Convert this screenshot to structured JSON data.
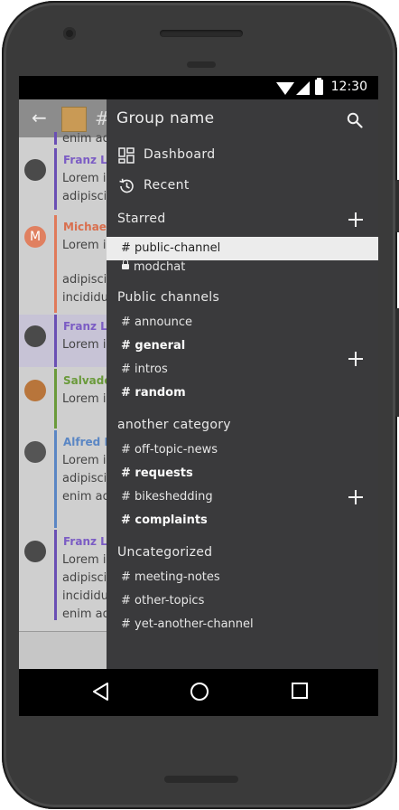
{
  "status_bar": {
    "time": "12:30"
  },
  "app_behind": {
    "header_hash": "#",
    "messages": [
      {
        "name": "Franz Lis",
        "name_color": "#7b5cc4",
        "bar_color": "#6a4fb4",
        "avatar_color": "#4a4a4a",
        "lines": [
          "Lorem ip",
          "adipisci"
        ],
        "highlight": false
      },
      {
        "name": "Michaeh",
        "name_color": "#d96f4e",
        "bar_color": "#e07a5a",
        "avatar_color": "#e08060",
        "avatar_letter": "M",
        "lines": [
          "Lorem ip",
          "adipisci",
          "incididu"
        ],
        "highlight": false
      },
      {
        "name": "Franz Lis",
        "name_color": "#7b5cc4",
        "bar_color": "#6a4fb4",
        "avatar_color": "#4a4a4a",
        "lines": [
          "Lorem ip"
        ],
        "highlight": true
      },
      {
        "name": "Salvador",
        "name_color": "#6a9a3a",
        "bar_color": "#6a9a3a",
        "avatar_color": "#b8753b",
        "lines": [
          "Lorem ip"
        ],
        "highlight": false
      },
      {
        "name": "Alfred H",
        "name_color": "#5a86c4",
        "bar_color": "#5a86c4",
        "avatar_color": "#555555",
        "lines": [
          "Lorem ip",
          "adipisci",
          "enim ad"
        ],
        "highlight": false
      },
      {
        "name": "Franz Lis",
        "name_color": "#7b5cc4",
        "bar_color": "#6a4fb4",
        "avatar_color": "#4a4a4a",
        "lines": [
          "Lorem ip",
          "adipisci",
          "incididu",
          "enim ad"
        ],
        "highlight": false
      }
    ],
    "top_partial_line": "enim ad"
  },
  "drawer": {
    "group_name": "Group name",
    "nav": [
      {
        "label": "Dashboard",
        "icon": "dashboard-icon"
      },
      {
        "label": "Recent",
        "icon": "history-icon"
      }
    ],
    "sections": [
      {
        "title": "Starred",
        "channels": [
          {
            "label": "# public-channel",
            "bold": false,
            "selected": true,
            "locked": false
          },
          {
            "label": "modchat",
            "bold": false,
            "selected": false,
            "locked": true
          }
        ]
      },
      {
        "title": "Public channels",
        "channels": [
          {
            "label": "# announce",
            "bold": false
          },
          {
            "label": "# general",
            "bold": true
          },
          {
            "label": "# intros",
            "bold": false
          },
          {
            "label": "# random",
            "bold": true
          }
        ]
      },
      {
        "title": "another category",
        "channels": [
          {
            "label": "# off-topic-news",
            "bold": false
          },
          {
            "label": "# requests",
            "bold": true
          },
          {
            "label": "# bikeshedding",
            "bold": false
          },
          {
            "label": "# complaints",
            "bold": true
          }
        ]
      },
      {
        "title": "Uncategorized",
        "channels": [
          {
            "label": "# meeting-notes",
            "bold": false
          },
          {
            "label": "# other-topics",
            "bold": false
          },
          {
            "label": "# yet-another-channel",
            "bold": false
          }
        ]
      }
    ]
  },
  "colors": {
    "drawer_bg": "#3a3a3c",
    "selected_bg": "#ececec",
    "header_bg": "#8c8c8c"
  }
}
